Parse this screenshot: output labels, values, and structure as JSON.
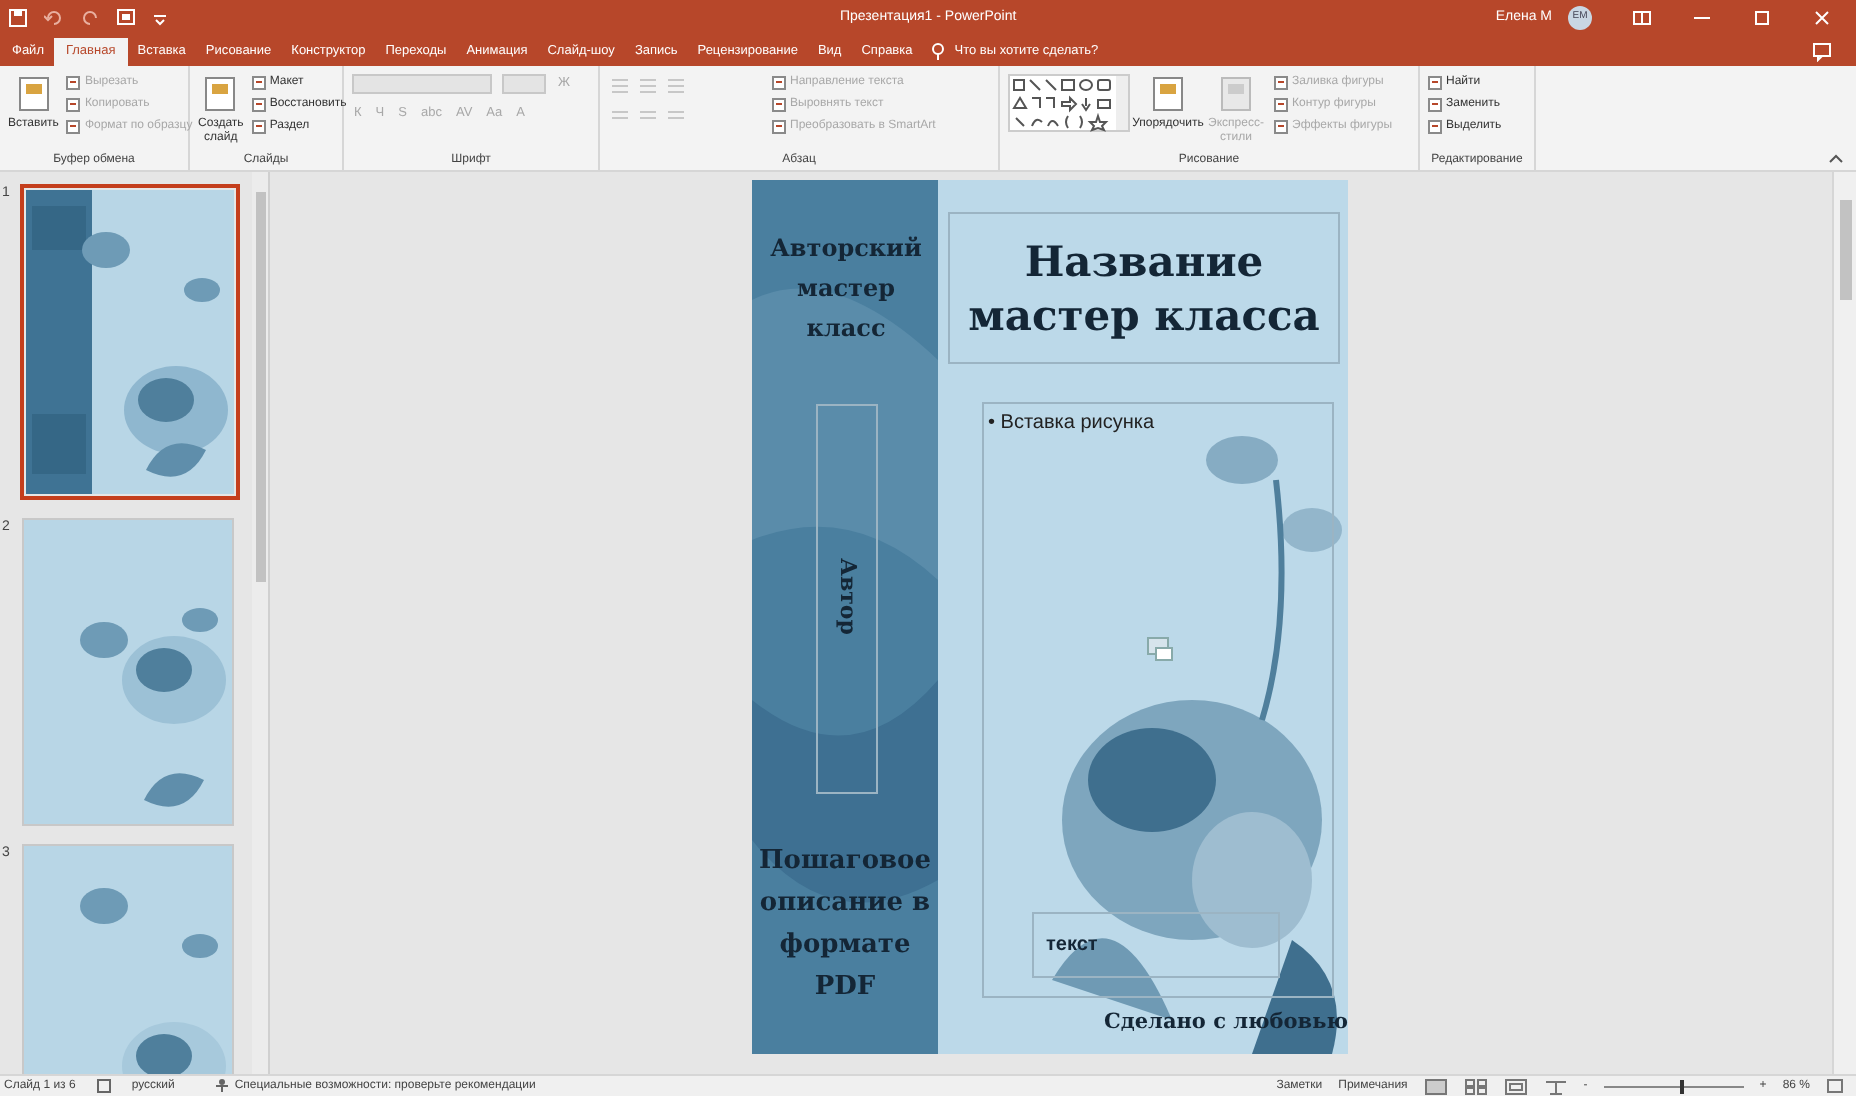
{
  "window": {
    "title": "Презентация1 - PowerPoint",
    "user": "Елена М",
    "avatar": "ЕМ"
  },
  "tabs": [
    {
      "label": "Файл",
      "selected": false
    },
    {
      "label": "Главная",
      "selected": true
    },
    {
      "label": "Вставка",
      "selected": false
    },
    {
      "label": "Рисование",
      "selected": false
    },
    {
      "label": "Конструктор",
      "selected": false
    },
    {
      "label": "Переходы",
      "selected": false
    },
    {
      "label": "Анимация",
      "selected": false
    },
    {
      "label": "Слайд-шоу",
      "selected": false
    },
    {
      "label": "Запись",
      "selected": false
    },
    {
      "label": "Рецензирование",
      "selected": false
    },
    {
      "label": "Вид",
      "selected": false
    },
    {
      "label": "Справка",
      "selected": false
    }
  ],
  "search": {
    "placeholder": "Что вы хотите сделать?"
  },
  "ribbon": [
    {
      "label": "Буфер обмена",
      "items": [
        {
          "kind": "big",
          "label": "Вставить",
          "disabled": false
        },
        {
          "kind": "small",
          "label": "Вырезать",
          "disabled": true
        },
        {
          "kind": "small",
          "label": "Копировать",
          "disabled": true
        },
        {
          "kind": "small",
          "label": "Формат по образцу",
          "disabled": true
        }
      ]
    },
    {
      "label": "Слайды",
      "items": [
        {
          "kind": "big",
          "label": "Создать слайд",
          "disabled": false
        },
        {
          "kind": "small",
          "label": "Макет",
          "disabled": false
        },
        {
          "kind": "small",
          "label": "Восстановить",
          "disabled": false
        },
        {
          "kind": "small",
          "label": "Раздел",
          "disabled": false
        }
      ]
    },
    {
      "label": "Шрифт",
      "items": [
        {
          "kind": "fontbox",
          "disabled": true
        },
        {
          "kind": "glyph",
          "label": "Ж",
          "disabled": true
        },
        {
          "kind": "glyph",
          "label": "К",
          "disabled": true
        },
        {
          "kind": "glyph",
          "label": "Ч",
          "disabled": true
        },
        {
          "kind": "glyph",
          "label": "S",
          "disabled": true
        },
        {
          "kind": "glyph",
          "label": "abc",
          "disabled": true
        },
        {
          "kind": "glyph",
          "label": "AV",
          "disabled": true
        },
        {
          "kind": "glyph",
          "label": "Aa",
          "disabled": true
        },
        {
          "kind": "glyph",
          "label": "A",
          "disabled": true
        }
      ]
    },
    {
      "label": "Абзац",
      "items": [
        {
          "kind": "lists",
          "disabled": true
        },
        {
          "kind": "small",
          "label": "Направление текста",
          "disabled": true
        },
        {
          "kind": "small",
          "label": "Выровнять текст",
          "disabled": true
        },
        {
          "kind": "small",
          "label": "Преобразовать в SmartArt",
          "disabled": true
        }
      ]
    },
    {
      "label": "Рисование",
      "items": [
        {
          "kind": "shapes",
          "disabled": false
        },
        {
          "kind": "big",
          "label": "Упорядочить",
          "disabled": false
        },
        {
          "kind": "big",
          "label": "Экспресс-стили",
          "disabled": true
        },
        {
          "kind": "small",
          "label": "Заливка фигуры",
          "disabled": true
        },
        {
          "kind": "small",
          "label": "Контур фигуры",
          "disabled": true
        },
        {
          "kind": "small",
          "label": "Эффекты фигуры",
          "disabled": true
        }
      ]
    },
    {
      "label": "Редактирование",
      "items": [
        {
          "kind": "small",
          "label": "Найти",
          "disabled": false
        },
        {
          "kind": "small",
          "label": "Заменить",
          "disabled": false
        },
        {
          "kind": "small",
          "label": "Выделить",
          "disabled": false
        }
      ]
    }
  ],
  "thumbnails": [
    {
      "number": "1",
      "selected": true
    },
    {
      "number": "2",
      "selected": false
    },
    {
      "number": "3",
      "selected": false
    }
  ],
  "slide": {
    "heading": "Авторский мастер класс",
    "author": "Автор",
    "description": "Пошаговое описание в формате PDF",
    "title": "Название мастер класса",
    "bullet": "• Вставка рисунка",
    "caption": "текст",
    "footer": "Сделано с любовью"
  },
  "status_bar": {
    "slide": "Слайд 1 из 6",
    "language": "русский",
    "accessibility": "Специальные возможности: проверьте рекомендации",
    "notes": "Заметки",
    "comments": "Примечания",
    "zoom_out": "-",
    "zoom_in": "+",
    "zoom": "86 %",
    "zoom_slider": {
      "level": 0.55
    }
  }
}
